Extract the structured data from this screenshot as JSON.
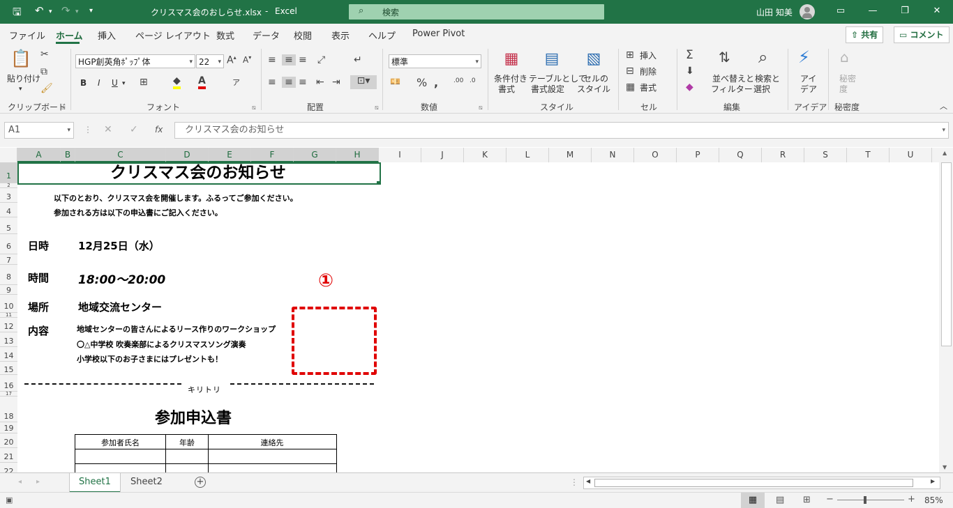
{
  "titlebar": {
    "filename": "クリスマス会のおしらせ.xlsx",
    "sep": "-",
    "app": "Excel",
    "search_placeholder": "検索",
    "user": "山田 知美"
  },
  "menu": {
    "tabs": [
      "ファイル",
      "ホーム",
      "挿入",
      "ページ レイアウト",
      "数式",
      "データ",
      "校閲",
      "表示",
      "ヘルプ",
      "Power Pivot"
    ],
    "active": "ホーム",
    "share": "共有",
    "comment": "コメント"
  },
  "ribbon": {
    "clipboard": {
      "paste": "貼り付け",
      "label": "クリップボード"
    },
    "font": {
      "family": "HGP創英角ﾎﾟｯﾌﾟ体",
      "size": "22",
      "bold": "B",
      "italic": "I",
      "underline": "U",
      "label": "フォント"
    },
    "alignment": {
      "label": "配置"
    },
    "number": {
      "format": "標準",
      "label": "数値"
    },
    "styles": {
      "conditional_l1": "条件付き",
      "conditional_l2": "書式",
      "table_l1": "テーブルとして",
      "table_l2": "書式設定",
      "cell_l1": "セルの",
      "cell_l2": "スタイル",
      "label": "スタイル"
    },
    "cells": {
      "insert": "挿入",
      "delete": "削除",
      "format": "書式",
      "label": "セル"
    },
    "editing": {
      "sort_l1": "並べ替えと",
      "sort_l2": "フィルター",
      "find_l1": "検索と",
      "find_l2": "選択",
      "label": "編集"
    },
    "ideas": {
      "l1": "アイ",
      "l2": "デア",
      "label": "アイデア"
    },
    "sensitivity": {
      "l1": "秘密",
      "l2": "度",
      "label": "秘密度"
    }
  },
  "formula_bar": {
    "name_box": "A1",
    "content": "クリスマス会のお知らせ"
  },
  "columns": [
    "A",
    "B",
    "C",
    "D",
    "E",
    "F",
    "G",
    "H",
    "I",
    "J",
    "K",
    "L",
    "M",
    "N",
    "O",
    "P",
    "Q",
    "R",
    "S",
    "T",
    "U"
  ],
  "rows": [
    "1",
    "2",
    "3",
    "4",
    "5",
    "6",
    "7",
    "8",
    "9",
    "10",
    "11",
    "12",
    "13",
    "14",
    "15",
    "16",
    "17",
    "18",
    "19",
    "20",
    "21",
    "22"
  ],
  "sheet": {
    "title": "クリスマス会のお知らせ",
    "intro1": "以下のとおり、クリスマス会を開催します。ふるってご参加ください。",
    "intro2": "参加される方は以下の申込書にご記入ください。",
    "date_label": "日時",
    "date_value": "12月25日（水）",
    "time_label": "時間",
    "time_value": "18:00～20:00",
    "place_label": "場所",
    "place_value": "地域交流センター",
    "content_label": "内容",
    "content1": "地域センターの皆さんによるリース作りのワークショップ",
    "content2": "〇△中学校 吹奏楽部によるクリスマスソング演奏",
    "content3": "小学校以下のお子さまにはプレゼントも！",
    "cutline": "キリトリ",
    "form_title": "参加申込書",
    "table_headers": [
      "参加者氏名",
      "年齢",
      "連絡先"
    ],
    "annotation_marker": "①"
  },
  "sheet_tabs": [
    "Sheet1",
    "Sheet2"
  ],
  "active_sheet": "Sheet1",
  "status": {
    "zoom": "85%"
  },
  "colors": {
    "excel_green": "#217346",
    "annotation_red": "#e00000"
  }
}
